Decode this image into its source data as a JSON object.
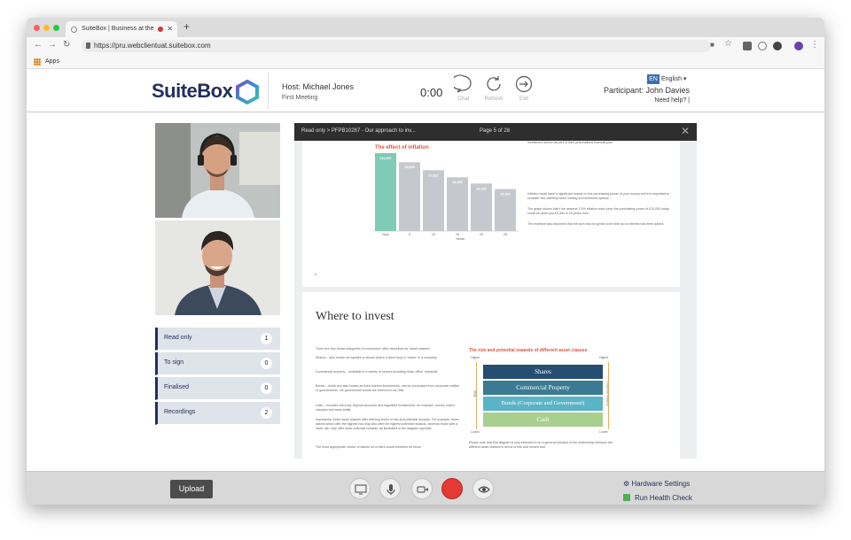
{
  "browser": {
    "tab_title": "SuiteBox | Business at the",
    "url": "https://pru.webclientuat.suitebox.com",
    "bookmarks_label": "Apps"
  },
  "header": {
    "logo_text": "SuiteBox",
    "host": "Host: Michael Jones",
    "meeting": "First Meeting",
    "timer": "0:00",
    "chat_label": "Chat",
    "refresh_label": "Refresh",
    "exit_label": "Exit",
    "lang_code": "EN",
    "lang_name": "English",
    "participant": "Participant: John Davies",
    "help": "Need help? |"
  },
  "sidebar": {
    "items": [
      {
        "label": "Read only",
        "count": "1"
      },
      {
        "label": "To sign",
        "count": "0"
      },
      {
        "label": "Finalised",
        "count": "0"
      },
      {
        "label": "Recordings",
        "count": "2"
      }
    ]
  },
  "viewer": {
    "doc_title": "Read only > PFPB10287 - Our approach to inv...",
    "page_info": "Page 5 of 28",
    "page1": {
      "top_text": "investment advice as part of their personalised financial plan.",
      "chart_title": "The effect of inflation",
      "xlabel": "Years",
      "para1": "Inflation could have a significant impact on the purchasing power of your money and it is important to consider this carefully when looking at investment options.",
      "para2": "The graph shows that if we assume 2.5% inflation each year, the purchasing power of £10,000 today could be worth just £5,394 in 25 years' time.",
      "para3": "The example also assumes that the sum has not grown over time as no interest has been added.",
      "page_num": "4"
    },
    "page2": {
      "heading": "Where to invest",
      "intro": "There are four broad categories of investment, often described as \"asset classes\".",
      "shares_text": "Shares – also known as equities or stocks where a client buys a \"share\" in a company.",
      "commercial_text": "Commercial property – available in a variety of sectors including retail, office, industrial.",
      "bonds_text": "Bonds – which are also known as fixed interest investments, can be purchased from corporate entities or governments. UK government bonds are referred to as Gilts.",
      "cash_text": "Cash – includes currency, deposit accounts and regulated investments, for example, money orders, cheques and bank drafts.",
      "risk_text": "Importantly, these asset classes offer differing levels of risk and potential rewards. For example, those assets which offer the highest risk may also offer the highest potential rewards, whereas those with a lower risk, may offer lower potential rewards, as illustrated in the diagram opposite.",
      "last_text": "The most appropriate choice of assets for a client would therefore be those",
      "diagram_title": "The risk and potential rewards of different asset classes",
      "higher": "Higher",
      "lower": "Lower",
      "risk": "Risk",
      "rewards": "Potential rewards",
      "note": "Please note that this diagram is only intended to be a general indicator of the relationship between the different asset classes in terms of risk and reward and"
    }
  },
  "chart_data": {
    "type": "bar",
    "title": "The effect of inflation",
    "categories": [
      "Now",
      "5",
      "10",
      "15",
      "20",
      "25"
    ],
    "values": [
      10000,
      8839,
      7812,
      6905,
      6103,
      5394
    ],
    "labels": [
      "£10,000",
      "£8,839",
      "£7,812",
      "£6,905",
      "£6,103",
      "£5,394"
    ],
    "xlabel": "Years",
    "ylabel": "",
    "ylim": [
      0,
      10000
    ],
    "colors": [
      "#7fcbb5",
      "#c5c9ce"
    ]
  },
  "asset_classes": [
    {
      "label": "Shares",
      "color": "#264d72"
    },
    {
      "label": "Commercial Property",
      "color": "#3c7a93"
    },
    {
      "label": "Bonds (Corporate and Government)",
      "color": "#5bb3c7"
    },
    {
      "label": "Cash",
      "color": "#a9cf8e"
    }
  ],
  "footer": {
    "upload_label": "Upload",
    "hardware_label": "Hardware Settings",
    "health_label": "Run Health Check"
  },
  "colors": {
    "brand": "#232f5c",
    "accent_red": "#e53935",
    "chart_title": "#e0553c"
  }
}
